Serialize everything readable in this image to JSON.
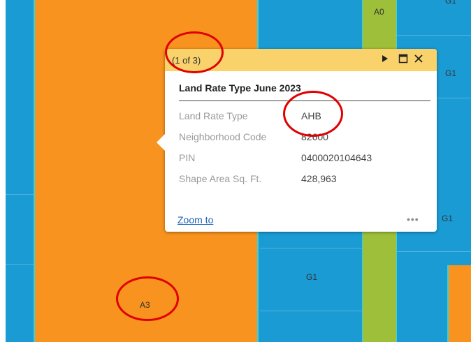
{
  "map": {
    "labels": {
      "a0": "A0",
      "g1_top": "G1",
      "g1_right": "G1",
      "g1_mid_right": "G1",
      "g1_bottom": "G1",
      "a3": "A3"
    }
  },
  "popup": {
    "pager": "(1 of 3)",
    "title": "Land Rate Type June 2023",
    "fields": [
      {
        "label": "Land Rate Type",
        "value": "AHB"
      },
      {
        "label": "Neighborhood Code",
        "value": "82600"
      },
      {
        "label": "PIN",
        "value": "0400020104643"
      },
      {
        "label": "Shape Area Sq. Ft.",
        "value": "428,963"
      }
    ],
    "zoom_label": "Zoom to",
    "more_label": "•••"
  },
  "colors": {
    "water": "#1a9bd4",
    "orange": "#f7931e",
    "green": "#9ebf3a",
    "header": "#f9d26b",
    "annotation": "#e10000"
  }
}
